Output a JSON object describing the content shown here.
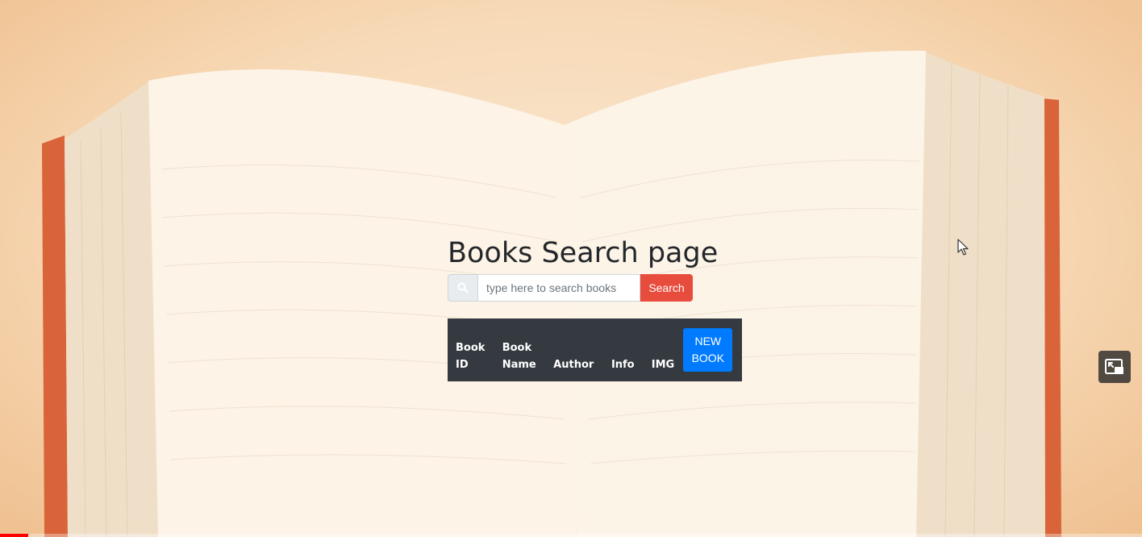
{
  "page": {
    "title": "Books Search page"
  },
  "search": {
    "icon": "search-icon",
    "placeholder": "type here to search books",
    "value": "",
    "button_label": "Search",
    "button_color": "#e74c3c"
  },
  "table": {
    "header_background": "#343a40",
    "columns": [
      {
        "line1": "Book",
        "line2": "ID"
      },
      {
        "line1": "Book",
        "line2": "Name"
      },
      {
        "line1": "",
        "line2": "Author"
      },
      {
        "line1": "",
        "line2": "Info"
      },
      {
        "line1": "",
        "line2": "IMG"
      }
    ],
    "new_book_button": {
      "line1": "NEW",
      "line2": "BOOK",
      "color": "#007bff"
    }
  },
  "player": {
    "miniplayer_icon": "miniplayer-icon",
    "progress_fraction": 0.025,
    "progress_color": "#ff0000"
  }
}
